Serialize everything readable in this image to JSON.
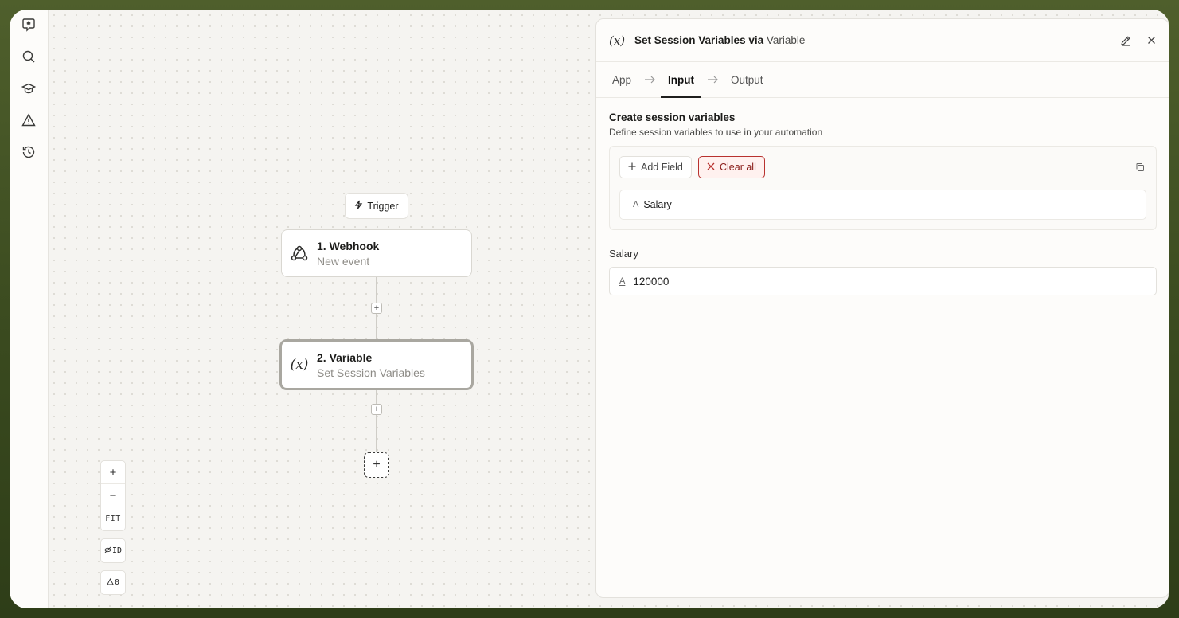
{
  "panel": {
    "icon": "variable-fx-icon",
    "title_main": "Set Session Variables via",
    "title_app": "Variable",
    "tabs": [
      {
        "label": "App"
      },
      {
        "label": "Input"
      },
      {
        "label": "Output"
      }
    ],
    "active_tab": "Input",
    "section_title": "Create session variables",
    "section_subtitle": "Define session variables to use in your automation",
    "add_field_label": "Add Field",
    "clear_all_label": "Clear all",
    "fields": [
      {
        "name": "Salary",
        "type_icon": "text-type-icon"
      }
    ],
    "value_label": "Salary",
    "value": "120000"
  },
  "canvas": {
    "trigger_label": "Trigger",
    "nodes": [
      {
        "title": "1. Webhook",
        "subtitle": "New event",
        "icon": "webhook-icon"
      },
      {
        "title": "2. Variable",
        "subtitle": "Set Session Variables",
        "icon": "variable-fx-icon"
      }
    ],
    "fx_glyph": "(x)",
    "zoom_in": "+",
    "zoom_out": "−",
    "fit": "FIT",
    "id_toggle": "ID",
    "warnings_count": "0"
  },
  "colors": {
    "clear_border": "#b8322f",
    "clear_text": "#8a1c18",
    "frame_bg": "#3a4a1f"
  }
}
